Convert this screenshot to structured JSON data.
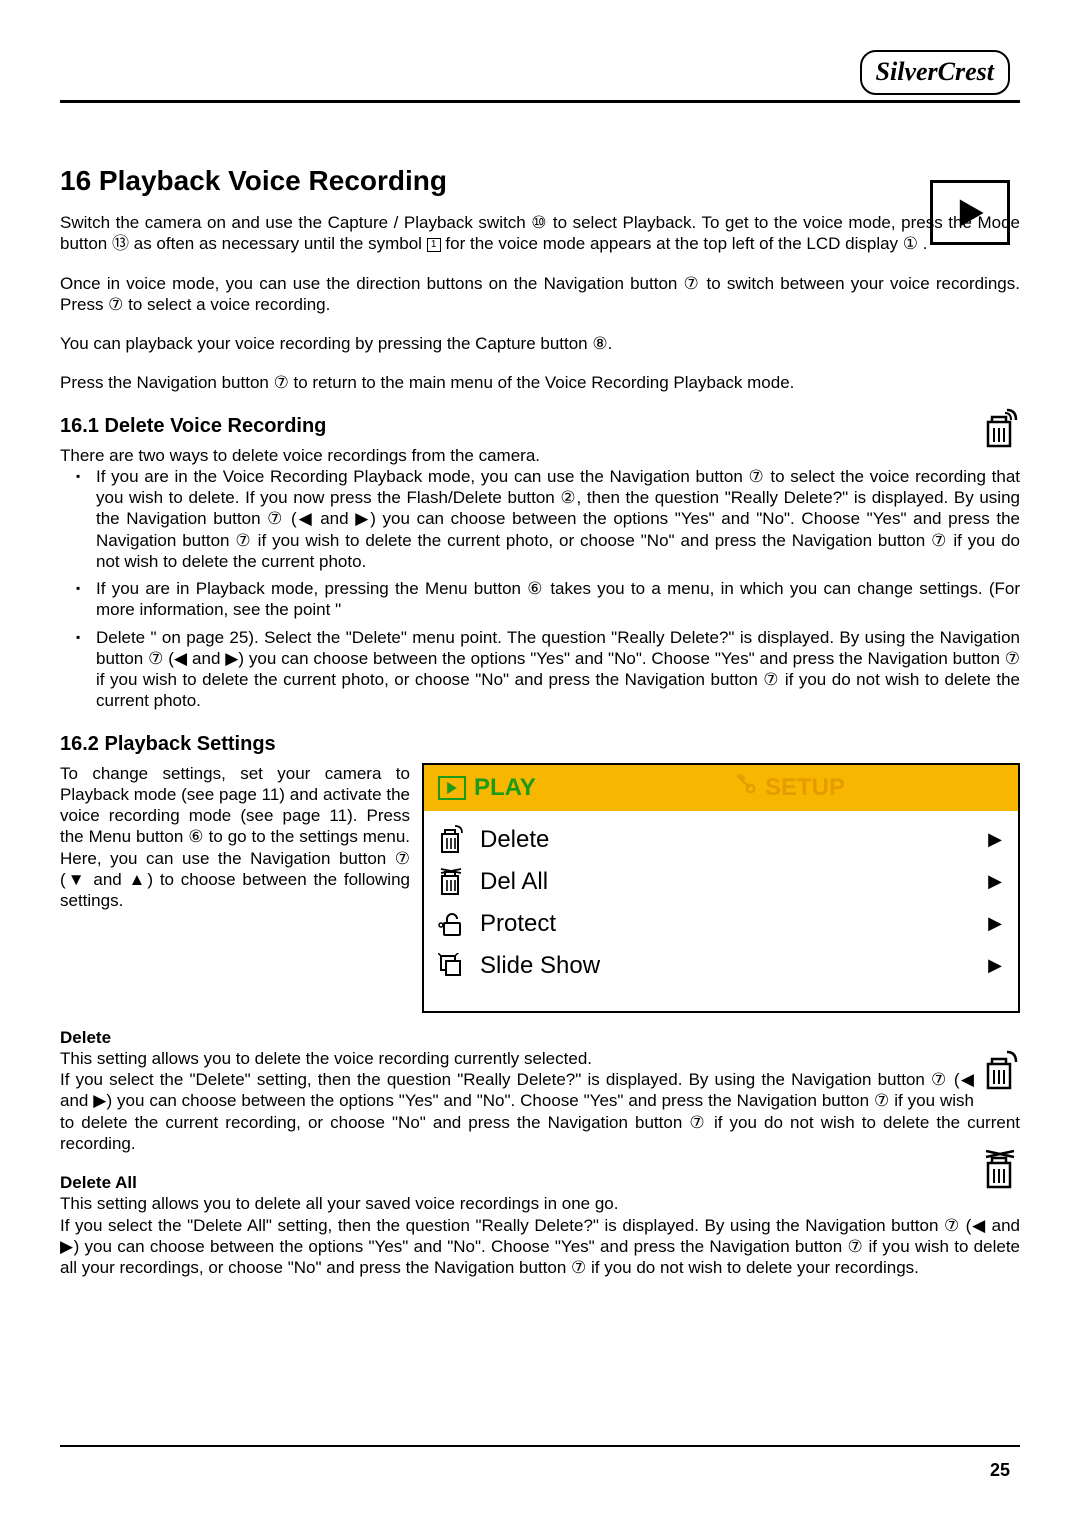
{
  "brand": "SilverCrest",
  "h1": "16 Playback Voice Recording",
  "intro1a": "Switch the camera on and use the Capture / Playback switch ",
  "intro1_ref1": "⑩",
  "intro1b": " to select Playback. To get to the voice mode, press the Mode button ",
  "intro1_ref2": "⑬",
  "intro1c": " as often as necessary until the symbol ",
  "intro1d": " for the voice mode appears at the top left of the LCD display ",
  "intro1_ref3": "①",
  "intro1e": ".",
  "intro2": "Once in voice mode, you can use the direction buttons on the Navigation button ⑦ to switch between your voice recordings. Press ⑦ to select a voice recording.",
  "intro3": "You can playback your voice recording by pressing the Capture button ⑧.",
  "intro4": "Press the Navigation button ⑦ to return to the main menu of the Voice Recording Playback mode.",
  "h2_1": "16.1  Delete Voice Recording",
  "del_intro": "There are two ways to delete voice recordings from the camera.",
  "bullets": [
    "If you are in the Voice Recording Playback mode, you can use the Navigation button ⑦ to select the voice recording that you wish to delete. If you now press the Flash/Delete button ②, then the question \"Really Delete?\" is displayed. By using the Navigation button ⑦ (◀ and ▶) you can choose between the options \"Yes\" and \"No\". Choose \"Yes\" and press the Navigation button ⑦ if you wish to delete the current photo, or choose \"No\" and press the Navigation button ⑦ if you do not wish to delete the current photo.",
    "If you are in Playback mode, pressing the Menu button ⑥ takes you to a menu, in which you can change settings. (For more information, see the point \"",
    "Delete \" on page 25). Select the \"Delete\" menu point. The question \"Really Delete?\" is displayed. By using the Navigation button ⑦ (◀ and ▶) you can choose between the options \"Yes\" and \"No\". Choose \"Yes\" and press the Navigation button ⑦ if you wish to delete the current photo, or choose \"No\" and press the Navigation button ⑦ if you do not wish to delete the current photo."
  ],
  "h2_2": "16.2  Playback Settings",
  "settings_text": "To change settings, set your camera to Playback mode (see page 11) and activate the voice recording mode (see page 11). Press the Menu button ⑥ to go to the settings menu. Here, you can use the Navigation button ⑦ (▼ and ▲) to choose between the following settings.",
  "menu": {
    "tab_play": "PLAY",
    "tab_setup": "SETUP",
    "items": [
      {
        "label": "Delete"
      },
      {
        "label": "Del All"
      },
      {
        "label": "Protect"
      },
      {
        "label": "Slide Show"
      }
    ]
  },
  "delete_h": "Delete",
  "delete_p1": "This setting allows you to delete the voice recording currently selected.",
  "delete_p2": "If you select the \"Delete\" setting, then the question \"Really Delete?\" is displayed. By using the Navigation button ⑦ (◀ and ▶) you can choose between the options \"Yes\" and \"No\". Choose \"Yes\" and press the Navigation button ⑦ if you wish to delete the current recording, or choose \"No\" and press the Navigation button ⑦ if you do not wish to delete the current recording.",
  "deleteall_h": "Delete All",
  "deleteall_p1": "This setting allows you to delete all your saved voice recordings in one go.",
  "deleteall_p2": "If you select the \"Delete All\" setting, then the question \"Really Delete?\" is displayed. By using the Navigation button ⑦ (◀ and ▶) you can choose between the options \"Yes\" and \"No\". Choose \"Yes\" and press the Navigation button ⑦ if you wish to delete all your recordings, or choose \"No\" and press the Navigation button ⑦ if you do not wish to delete your recordings.",
  "page_number": "25"
}
